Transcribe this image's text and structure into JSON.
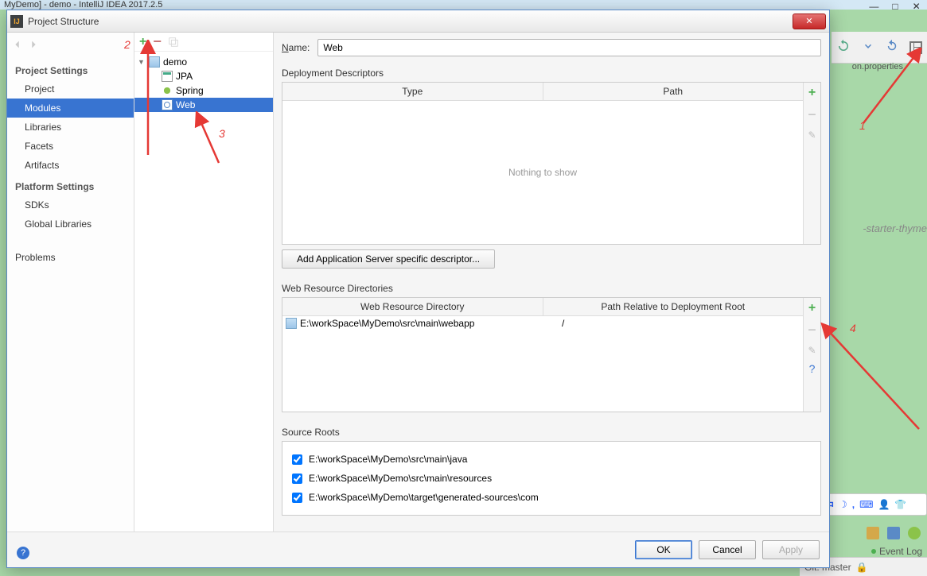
{
  "bg": {
    "top_text": "MyDemo] - demo - IntelliJ IDEA 2017.2.5",
    "tab_right": "on.properties",
    "code_hint": "-starter-thyme",
    "event_log": "Event Log",
    "git": "Git: master"
  },
  "dialog": {
    "title": "Project Structure"
  },
  "sidebar": {
    "project_settings": "Project Settings",
    "items1": [
      "Project",
      "Modules",
      "Libraries",
      "Facets",
      "Artifacts"
    ],
    "selected1": "Modules",
    "platform_settings": "Platform Settings",
    "items2": [
      "SDKs",
      "Global Libraries"
    ],
    "problems": "Problems"
  },
  "tree": {
    "root": "demo",
    "children": [
      "JPA",
      "Spring",
      "Web"
    ],
    "selected": "Web"
  },
  "main": {
    "name_label": "Name:",
    "name_value": "Web",
    "dd_title": "Deployment Descriptors",
    "dd_cols": [
      "Type",
      "Path"
    ],
    "dd_empty": "Nothing to show",
    "add_server_btn": "Add Application Server specific descriptor...",
    "wrd_title": "Web Resource Directories",
    "wrd_cols": [
      "Web Resource Directory",
      "Path Relative to Deployment Root"
    ],
    "wrd_rows": [
      {
        "dir": "E:\\workSpace\\MyDemo\\src\\main\\webapp",
        "path": "/"
      }
    ],
    "src_title": "Source Roots",
    "src_rows": [
      "E:\\workSpace\\MyDemo\\src\\main\\java",
      "E:\\workSpace\\MyDemo\\src\\main\\resources",
      "E:\\workSpace\\MyDemo\\target\\generated-sources\\com"
    ]
  },
  "buttons": {
    "ok": "OK",
    "cancel": "Cancel",
    "apply": "Apply"
  },
  "anno": {
    "a1": "1",
    "a2": "2",
    "a3": "3",
    "a4": "4"
  }
}
